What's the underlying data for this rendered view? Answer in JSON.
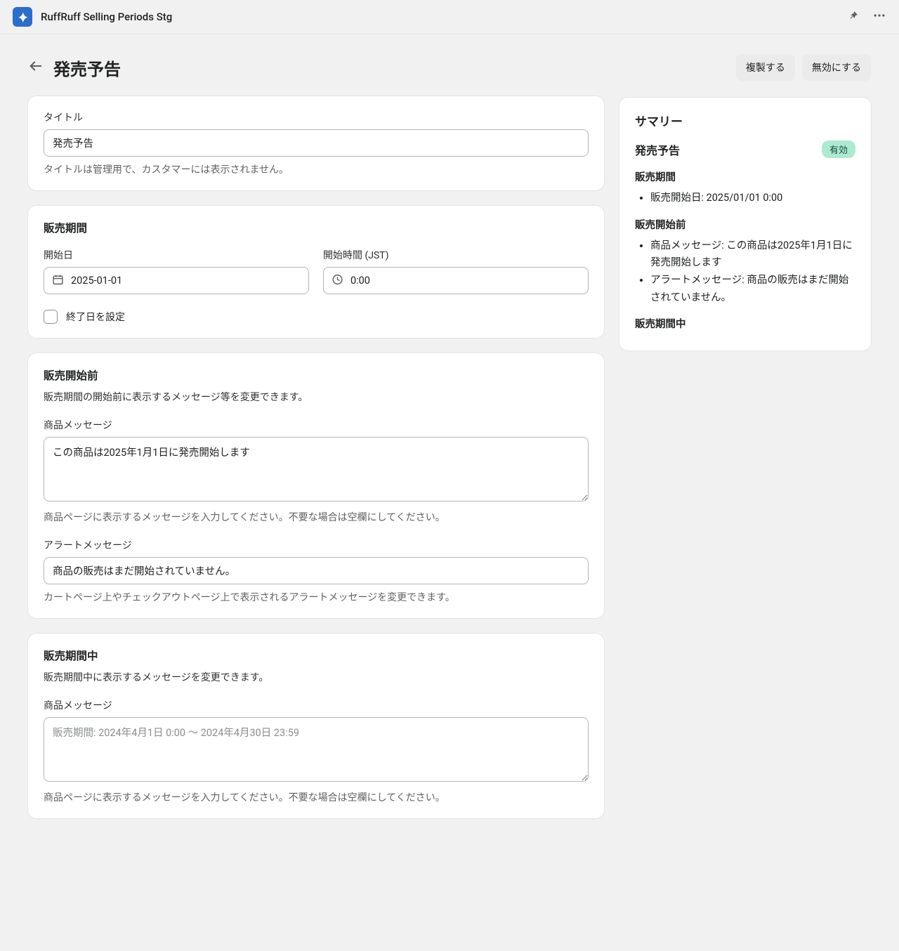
{
  "topbar": {
    "app_name": "RuffRuff Selling Periods Stg"
  },
  "header": {
    "title": "発売予告",
    "duplicate": "複製する",
    "disable": "無効にする"
  },
  "title_card": {
    "label": "タイトル",
    "value": "発売予告",
    "help": "タイトルは管理用で、カスタマーには表示されません。"
  },
  "period_card": {
    "title": "販売期間",
    "start_date_label": "開始日",
    "start_date_value": "2025-01-01",
    "start_time_label": "開始時間 (JST)",
    "start_time_value": "0:00",
    "set_end_label": "終了日を設定"
  },
  "before_card": {
    "title": "販売開始前",
    "sub": "販売期間の開始前に表示するメッセージ等を変更できます。",
    "product_msg_label": "商品メッセージ",
    "product_msg_value": "この商品は2025年1月1日に発売開始します",
    "product_msg_help": "商品ページに表示するメッセージを入力してください。不要な場合は空欄にしてください。",
    "alert_msg_label": "アラートメッセージ",
    "alert_msg_value": "商品の販売はまだ開始されていません。",
    "alert_msg_help": "カートページ上やチェックアウトページ上で表示されるアラートメッセージを変更できます。"
  },
  "during_card": {
    "title": "販売期間中",
    "sub": "販売期間中に表示するメッセージを変更できます。",
    "product_msg_label": "商品メッセージ",
    "product_msg_placeholder": "販売期間: 2024年4月1日 0:00 〜 2024年4月30日 23:59",
    "product_msg_help": "商品ページに表示するメッセージを入力してください。不要な場合は空欄にしてください。"
  },
  "summary": {
    "title": "サマリー",
    "name": "発売予告",
    "badge": "有効",
    "period_label": "販売期間",
    "period_item": "販売開始日: 2025/01/01 0:00",
    "before_label": "販売開始前",
    "before_item1": "商品メッセージ: この商品は2025年1月1日に発売開始します",
    "before_item2": "アラートメッセージ: 商品の販売はまだ開始されていません。",
    "during_label": "販売期間中"
  }
}
